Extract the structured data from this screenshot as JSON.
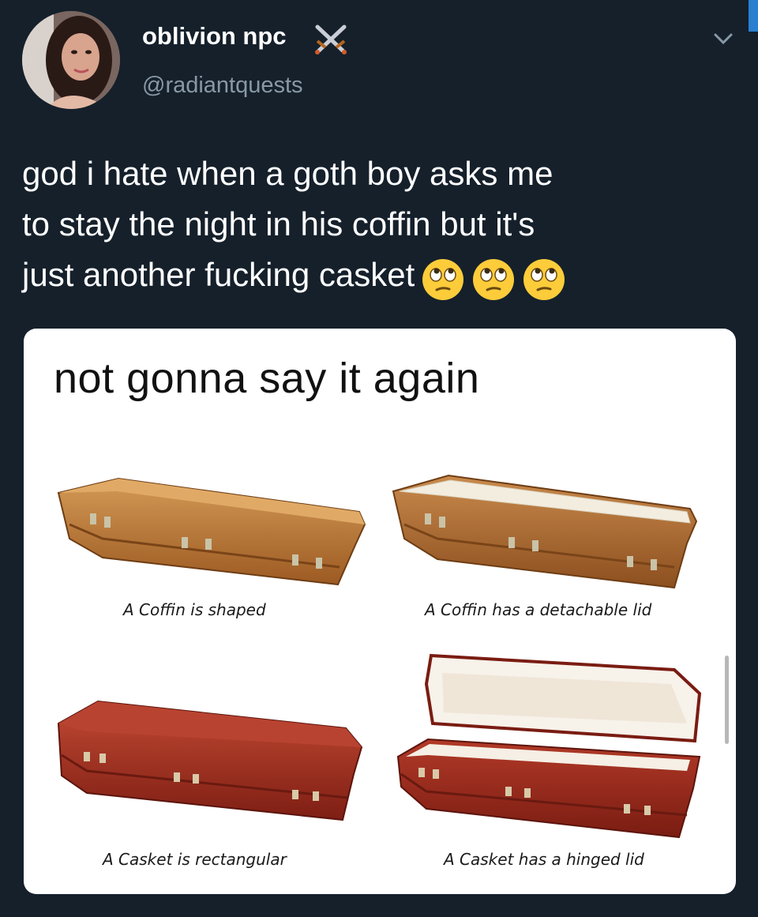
{
  "user": {
    "display_name": "oblivion npc",
    "handle": "@radiantquests",
    "name_emoji": "crossed-swords-icon"
  },
  "tweet": {
    "lines": [
      "god i hate when a goth boy asks me",
      "to stay the night in his coffin but it's",
      "just another fucking casket"
    ],
    "emojis": [
      "face-with-rolling-eyes-icon",
      "face-with-rolling-eyes-icon",
      "face-with-rolling-eyes-icon"
    ]
  },
  "card": {
    "title": "not gonna say it again",
    "captions": [
      "A Coffin is shaped",
      "A Coffin has a detachable lid",
      "A Casket is rectangular",
      "A Casket has a hinged lid"
    ]
  },
  "colors": {
    "background": "#15202b",
    "handle": "#8899a6",
    "coffin_wood": "#b87333",
    "casket_wood": "#a52a1e"
  }
}
